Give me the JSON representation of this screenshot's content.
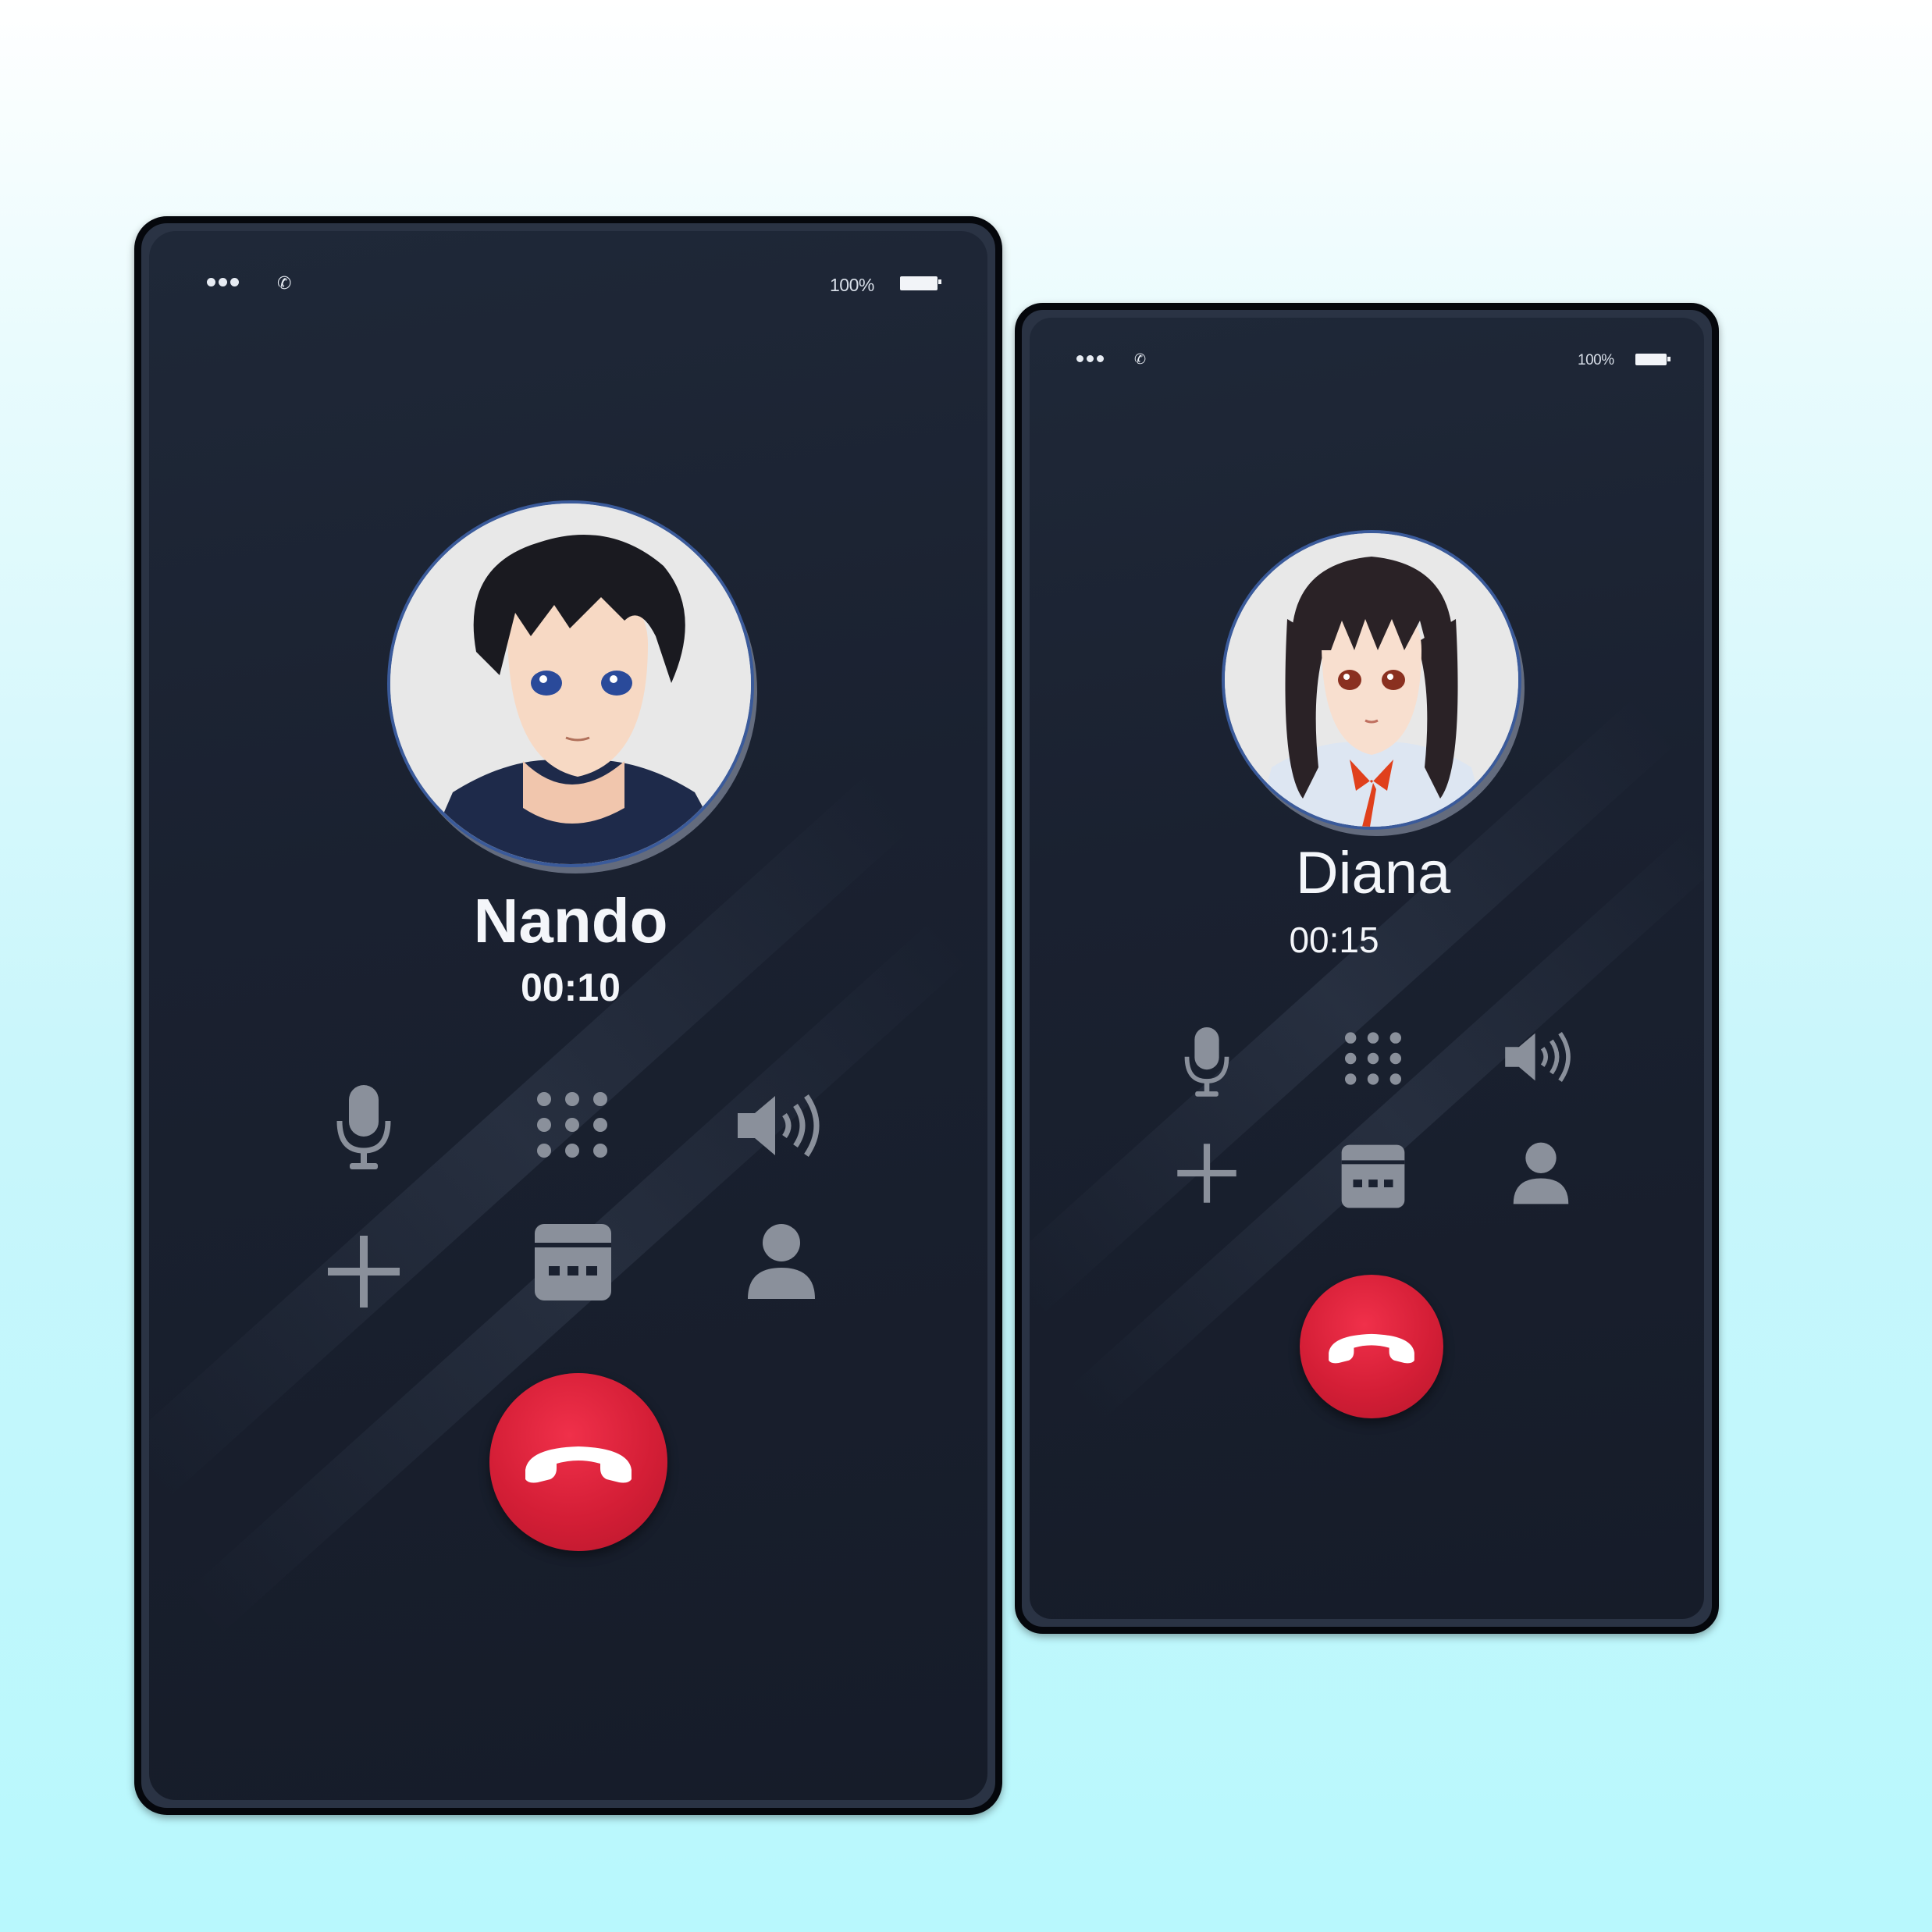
{
  "phones": [
    {
      "status": {
        "signal_icon": "signal-dots-icon",
        "call_icon": "phone-icon",
        "battery_text": "100%",
        "battery_icon": "battery-icon"
      },
      "caller": {
        "name": "Nando",
        "timer": "00:10",
        "avatar": "male-anime-avatar"
      },
      "controls": [
        "microphone-icon",
        "keypad-icon",
        "speaker-icon",
        "add-call-icon",
        "video-calendar-icon",
        "contact-icon"
      ],
      "end_call": {
        "icon": "hang-up-icon",
        "color": "#d41e36"
      }
    },
    {
      "status": {
        "signal_icon": "signal-dots-icon",
        "call_icon": "phone-icon",
        "battery_text": "100%",
        "battery_icon": "battery-icon"
      },
      "caller": {
        "name": "Diana",
        "timer": "00:15",
        "avatar": "female-anime-avatar"
      },
      "controls": [
        "microphone-icon",
        "keypad-icon",
        "speaker-icon",
        "add-call-icon",
        "video-calendar-icon",
        "contact-icon"
      ],
      "end_call": {
        "icon": "hang-up-icon",
        "color": "#d41e36"
      }
    }
  ],
  "colors": {
    "background_top": "#ffffff",
    "background_bottom": "#b8f8fd",
    "screen": "#1a2130",
    "icon_gray": "#8a909b",
    "end_call_red": "#d41e36"
  }
}
